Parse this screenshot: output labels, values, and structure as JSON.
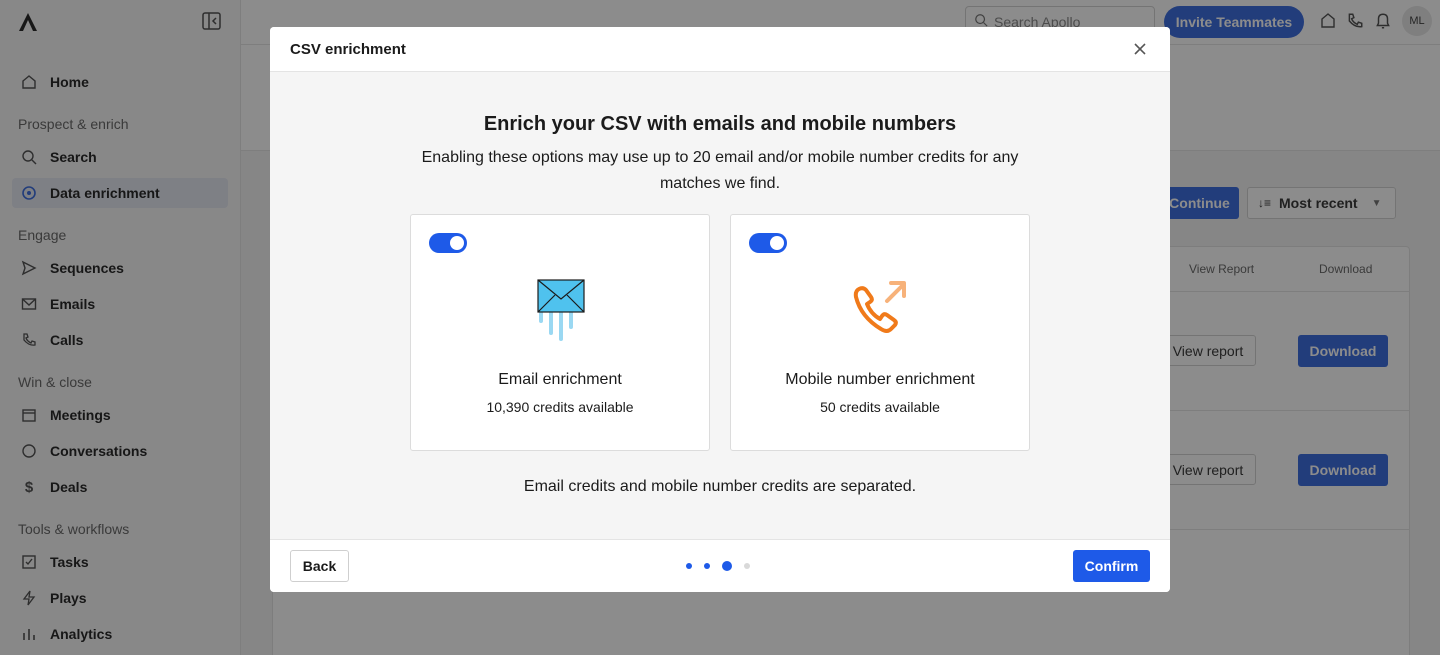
{
  "sidebar": {
    "home": "Home",
    "sections": {
      "prospect": "Prospect & enrich",
      "engage": "Engage",
      "win": "Win & close",
      "tools": "Tools & workflows"
    },
    "items": {
      "search": "Search",
      "data_enrichment": "Data enrichment",
      "sequences": "Sequences",
      "emails": "Emails",
      "calls": "Calls",
      "meetings": "Meetings",
      "conversations": "Conversations",
      "deals": "Deals",
      "tasks": "Tasks",
      "plays": "Plays",
      "analytics": "Analytics"
    }
  },
  "topbar": {
    "search_placeholder": "Search Apollo",
    "invite_label": "Invite Teammates",
    "avatar_initials": "ML"
  },
  "background": {
    "continue_label": "Continue",
    "sort_label": "Most recent",
    "col_view_report": "View Report",
    "col_download": "Download",
    "rows": [
      {
        "view": "View report",
        "download": "Download"
      },
      {
        "view": "View report",
        "download": "Download"
      }
    ]
  },
  "modal": {
    "title": "CSV enrichment",
    "headline": "Enrich your CSV with emails and mobile numbers",
    "subtext": "Enabling these options may use up to 20 email and/or mobile number credits for any matches we find.",
    "email_card": {
      "title": "Email enrichment",
      "credits": "10,390 credits available",
      "enabled": true,
      "icon": "envelope-icon"
    },
    "mobile_card": {
      "title": "Mobile number enrichment",
      "credits": "50 credits available",
      "enabled": true,
      "icon": "phone-outgoing-icon"
    },
    "footnote": "Email credits and mobile number credits are separated.",
    "back_label": "Back",
    "confirm_label": "Confirm",
    "step_current": 3,
    "step_total": 4
  },
  "colors": {
    "primary": "#1e5ae8",
    "email_icon": "#3fb8e8",
    "phone_icon": "#f07a1a"
  }
}
